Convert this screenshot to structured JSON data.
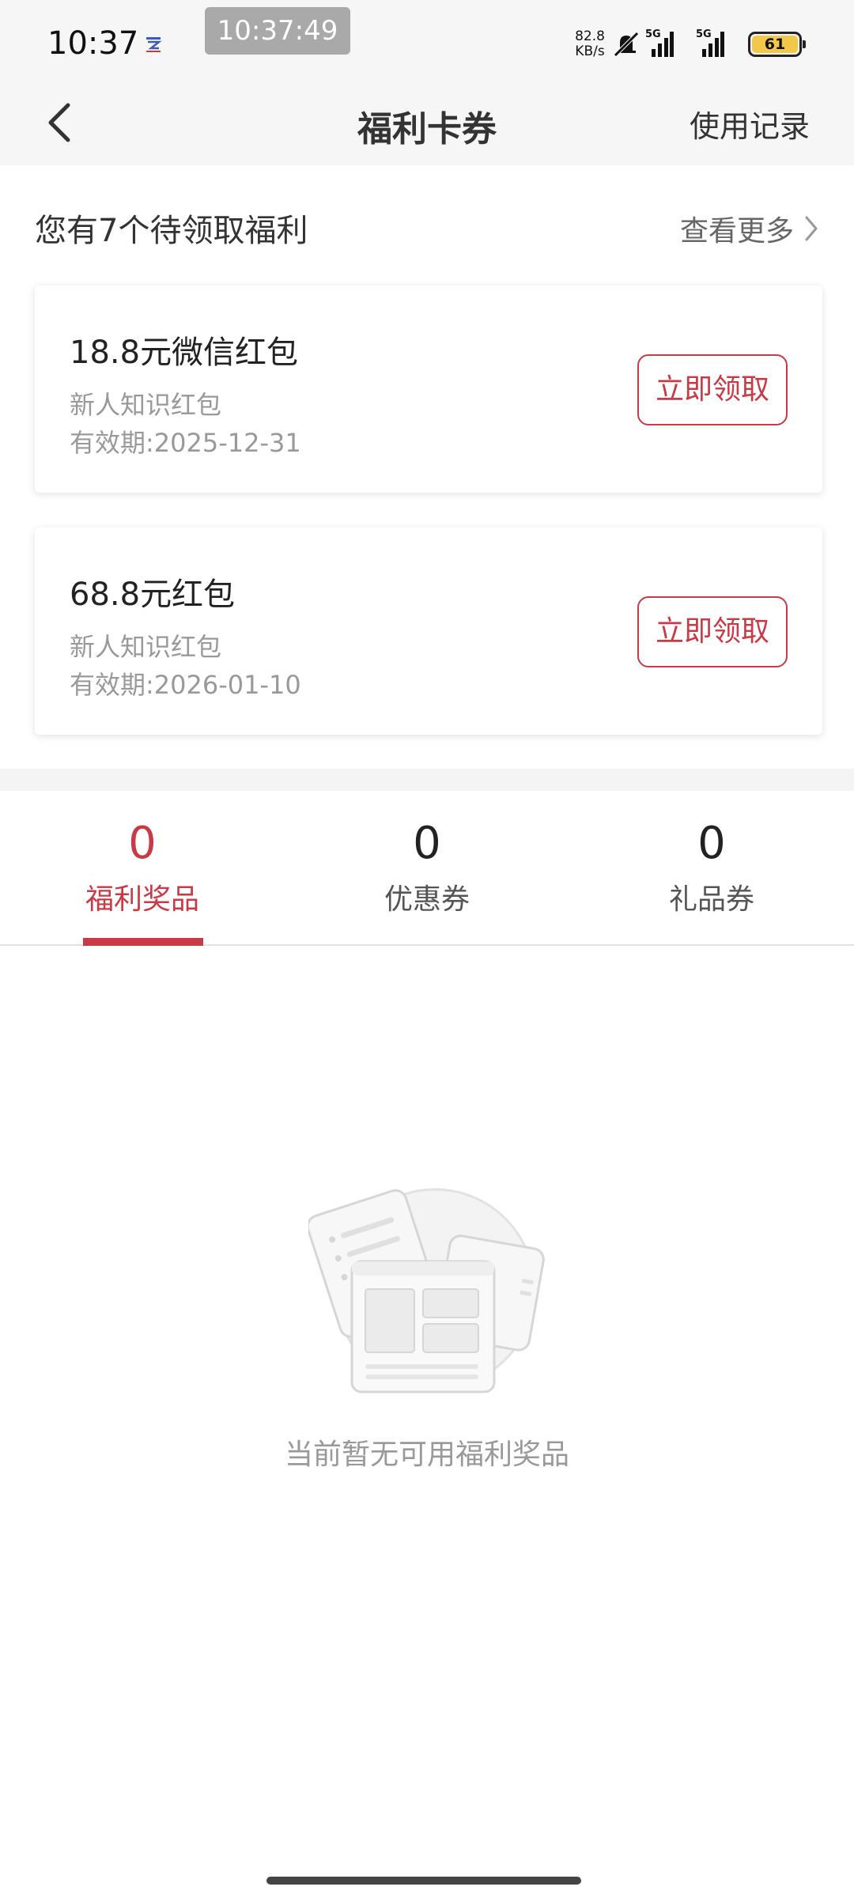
{
  "status_bar": {
    "time": "10:37",
    "timestamp_overlay": "10:37:49",
    "net_speed_value": "82.8",
    "net_speed_unit": "KB/s",
    "network_type_1": "5G",
    "network_type_2": "5G",
    "battery_level": "61",
    "battery_color": "#f3c84a"
  },
  "nav": {
    "title": "福利卡券",
    "record_label": "使用记录"
  },
  "pending": {
    "title": "您有7个待领取福利",
    "more_label": "查看更多"
  },
  "coupons": [
    {
      "title": "18.8元微信红包",
      "subtitle": "新人知识红包",
      "validity": "有效期:2025-12-31",
      "button_label": "立即领取"
    },
    {
      "title": "68.8元红包",
      "subtitle": "新人知识红包",
      "validity": "有效期:2026-01-10",
      "button_label": "立即领取"
    }
  ],
  "tabs": [
    {
      "count": "0",
      "label": "福利奖品",
      "active": true
    },
    {
      "count": "0",
      "label": "优惠券",
      "active": false
    },
    {
      "count": "0",
      "label": "礼品券",
      "active": false
    }
  ],
  "empty_state": {
    "message": "当前暂无可用福利奖品"
  },
  "colors": {
    "accent": "#c83a46",
    "header_bg": "#f6f6f6"
  }
}
